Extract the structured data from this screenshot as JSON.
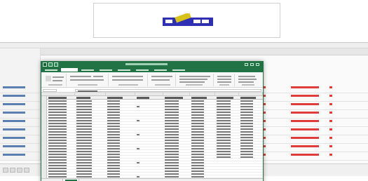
{
  "banner": {
    "logo_text": "",
    "brand_colors": {
      "blue": "#2f2fb4",
      "yellow": "#d8c21a",
      "green": "#3a8a3a"
    }
  },
  "webapp": {
    "header_left": "",
    "footer_text": "",
    "accent_colors": {
      "link": "#5a7fb0",
      "alert": "#e03c3c"
    }
  },
  "excel": {
    "window_title": "",
    "ribbon_tabs": [],
    "formula_cell_ref": "",
    "formula_value": "",
    "sheet_tab": "",
    "status_left": "",
    "zoom": "",
    "theme_color": "#217346"
  }
}
